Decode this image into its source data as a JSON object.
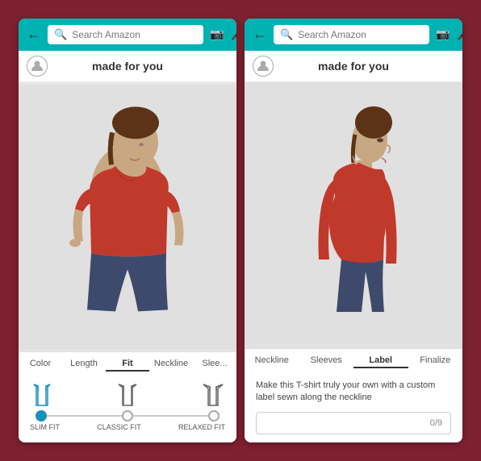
{
  "app": {
    "search_placeholder": "Search Amazon"
  },
  "left_panel": {
    "header_title": "made for you",
    "tabs": [
      {
        "label": "Color",
        "active": false
      },
      {
        "label": "Length",
        "active": false
      },
      {
        "label": "Fit",
        "active": true
      },
      {
        "label": "Neckline",
        "active": false
      },
      {
        "label": "Slee...",
        "active": false
      }
    ],
    "fit": {
      "options": [
        {
          "label": "SLIM FIT",
          "selected": true
        },
        {
          "label": "CLASSIC FIT",
          "selected": false
        },
        {
          "label": "RELAXED FIT",
          "selected": false
        }
      ]
    }
  },
  "right_panel": {
    "header_title": "made for you",
    "tabs": [
      {
        "label": "Neckline",
        "active": false
      },
      {
        "label": "Sleeves",
        "active": false
      },
      {
        "label": "Label",
        "active": true
      },
      {
        "label": "Finalize",
        "active": false
      }
    ],
    "label": {
      "description": "Make this T-shirt truly your own with a custom label sewn along the neckline",
      "input_placeholder": "",
      "counter": "0/9"
    }
  }
}
